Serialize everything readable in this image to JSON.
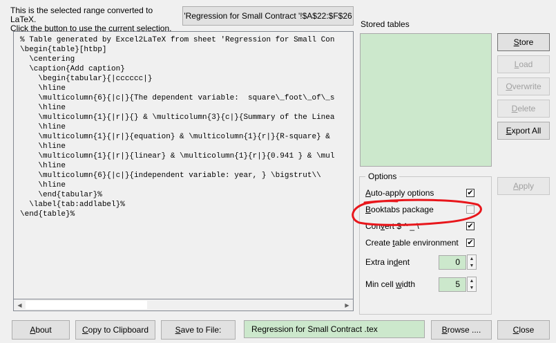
{
  "info": {
    "line1": "This is the selected range converted to LaTeX.",
    "line2": "Click the button to use the current selection."
  },
  "range_button": "'Regression for Small Contract '!$A$22:$F$26",
  "code_lines": [
    "% Table generated by Excel2LaTeX from sheet 'Regression for Small Con",
    "\\begin{table}[htbp]",
    "  \\centering",
    "  \\caption{Add caption}",
    "    \\begin{tabular}{|cccccc|}",
    "    \\hline",
    "    \\multicolumn{6}{|c|}{The dependent variable:  square\\_foot\\_of\\_s",
    "    \\hline",
    "    \\multicolumn{1}{|r|}{} & \\multicolumn{3}{c|}{Summary of the Linea",
    "    \\hline",
    "    \\multicolumn{1}{|r|}{equation} & \\multicolumn{1}{r|}{R-square} &",
    "    \\hline",
    "    \\multicolumn{1}{|r|}{linear} & \\multicolumn{1}{r|}{0.941 } & \\mul",
    "    \\hline",
    "    \\multicolumn{6}{|c|}{independent variable: year, } \\bigstrut\\\\",
    "    \\hline",
    "    \\end{tabular}%",
    "  \\label{tab:addlabel}%",
    "\\end{table}%"
  ],
  "stored_tables_label": "Stored tables",
  "side_buttons": {
    "store": {
      "pre": "",
      "u": "S",
      "post": "tore"
    },
    "load": {
      "pre": "",
      "u": "L",
      "post": "oad"
    },
    "overwrite": {
      "pre": "",
      "u": "O",
      "post": "verwrite"
    },
    "delete": {
      "pre": "",
      "u": "D",
      "post": "elete"
    },
    "export_all": {
      "pre": "",
      "u": "E",
      "post": "xport All"
    },
    "apply": {
      "pre": "",
      "u": "A",
      "post": "pply"
    }
  },
  "options": {
    "title": "Options",
    "auto_apply": {
      "pre": "",
      "u": "A",
      "post": "uto-apply options",
      "checked": true
    },
    "booktabs": {
      "pre": "",
      "u": "B",
      "post": "ooktabs package",
      "checked": false
    },
    "convert": {
      "pre": "Con",
      "u": "v",
      "post": "ert $ ^ _ \\",
      "checked": true
    },
    "create_env": {
      "pre": "Create ",
      "u": "t",
      "post": "able environment",
      "checked": true
    },
    "extra_indent": {
      "pre": "Extra in",
      "u": "d",
      "post": "ent",
      "value": "0"
    },
    "min_cell_width": {
      "pre": "Min cell ",
      "u": "w",
      "post": "idth",
      "value": "5"
    }
  },
  "bottom_buttons": {
    "about": {
      "pre": "",
      "u": "A",
      "post": "bout"
    },
    "copy": {
      "pre": "",
      "u": "C",
      "post": "opy to Clipboard"
    },
    "save": {
      "pre": "",
      "u": "S",
      "post": "ave to File:"
    },
    "browse": {
      "pre": "",
      "u": "B",
      "post": "rowse ...."
    },
    "close": {
      "pre": "",
      "u": "C",
      "post": "lose"
    }
  },
  "filename": "Regression for Small Contract .tex",
  "colors": {
    "field_bg": "#cce8cc",
    "annotation": "#e8161b",
    "window_bg": "#f0f0f0"
  }
}
